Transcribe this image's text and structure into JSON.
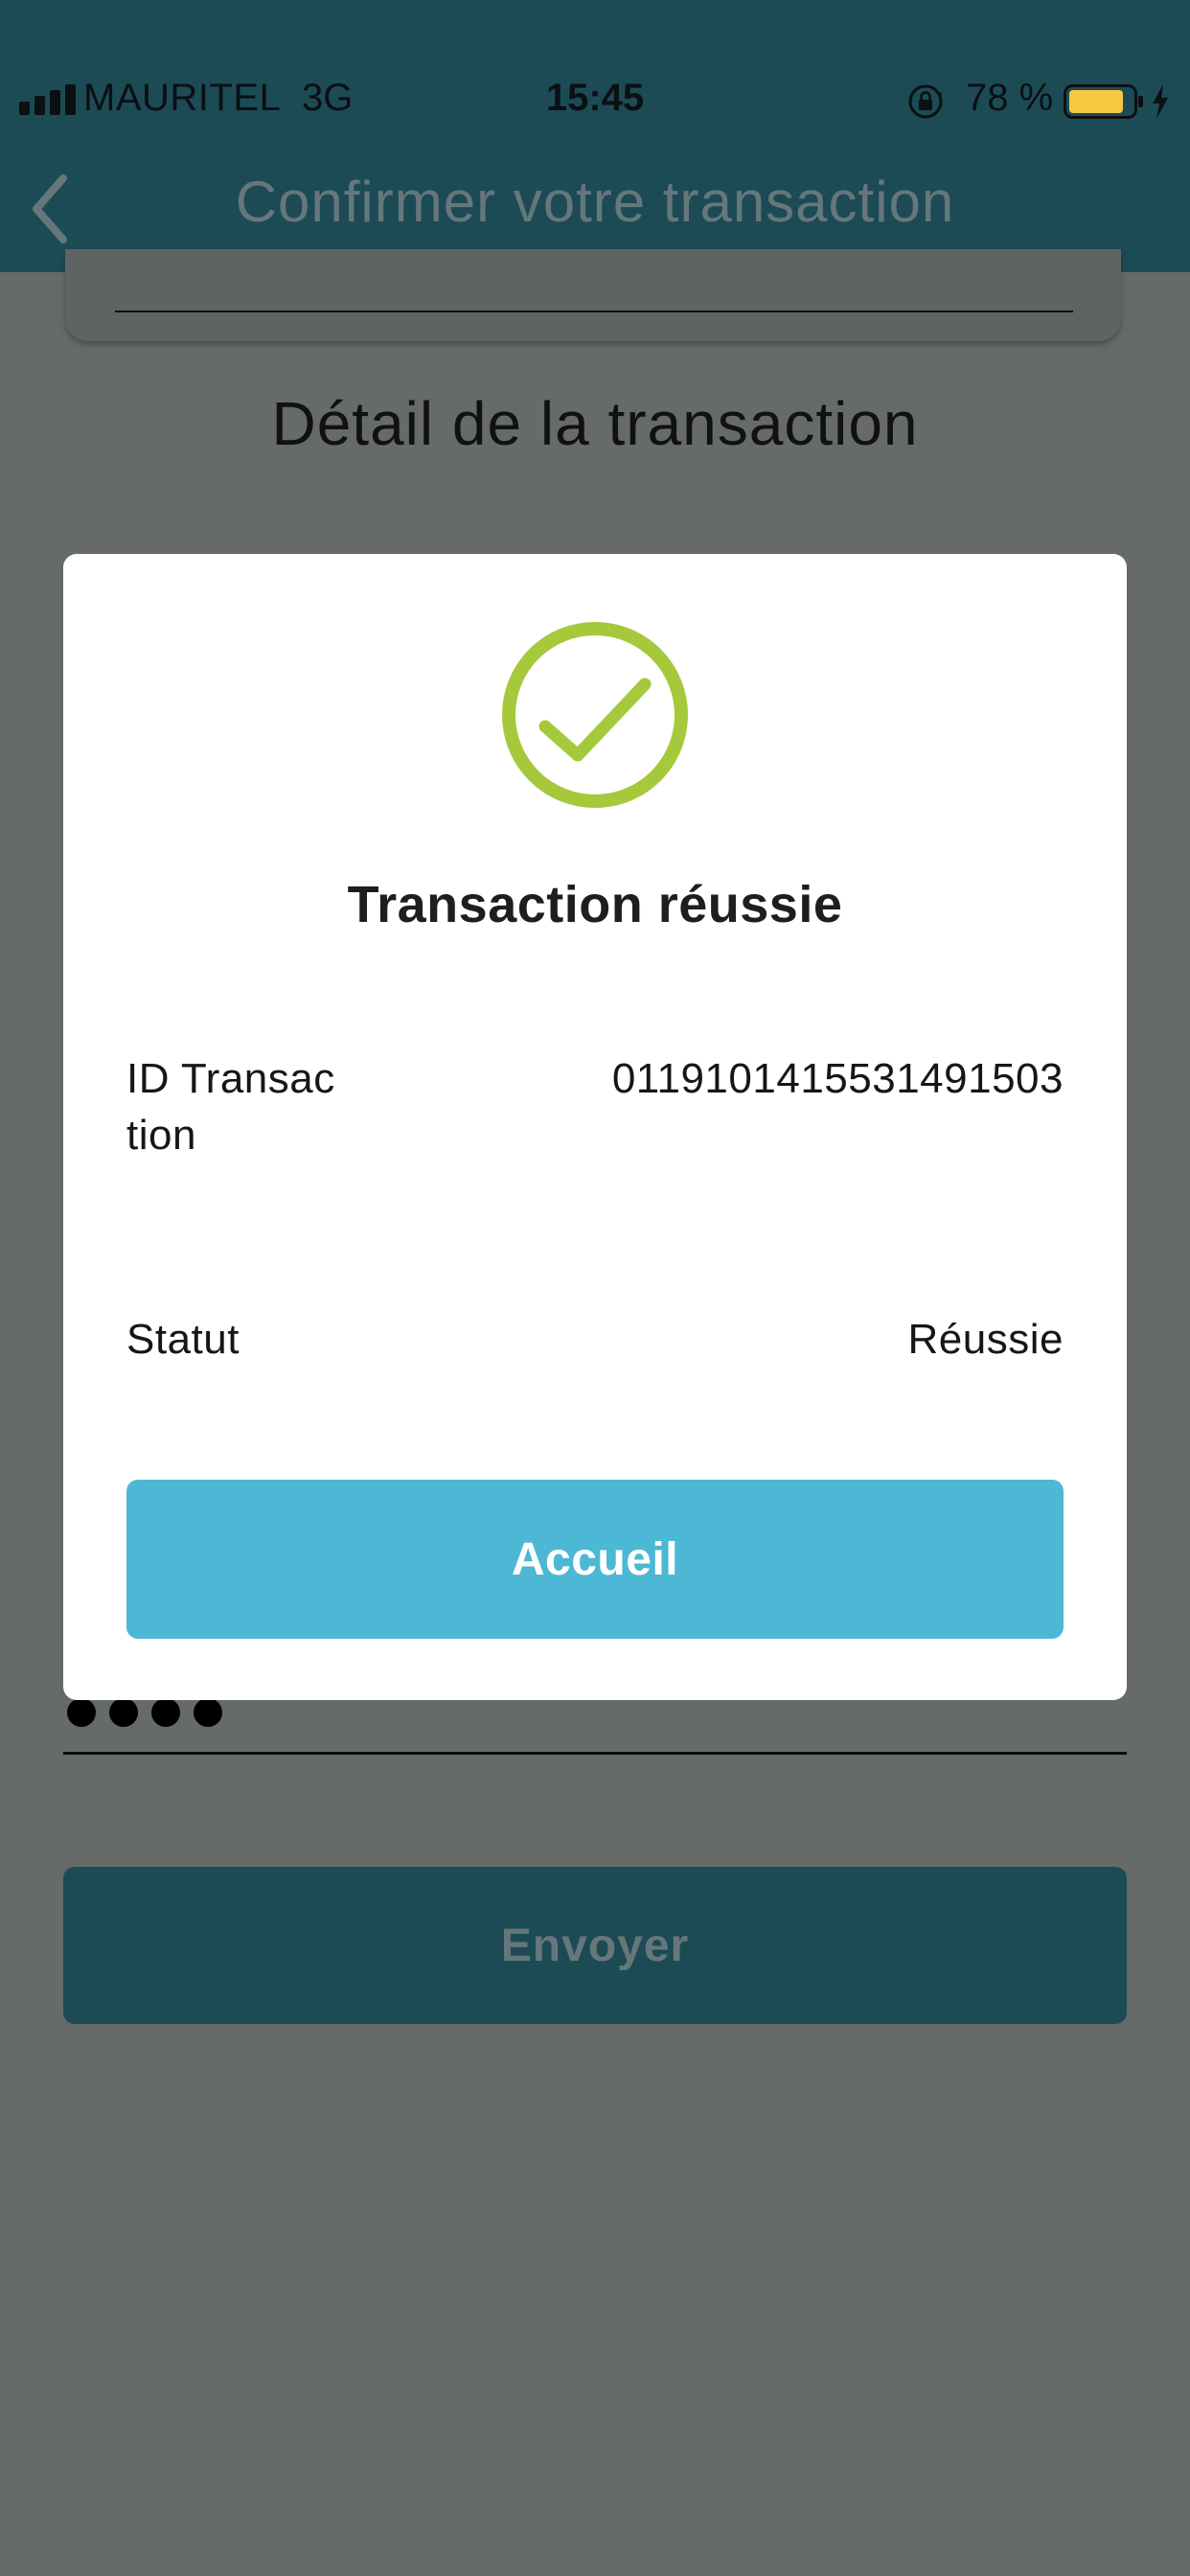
{
  "status_bar": {
    "carrier": "MAURITEL",
    "network": "3G",
    "time": "15:45",
    "battery": "78 %"
  },
  "header": {
    "title": "Confirmer votre transaction"
  },
  "background": {
    "section_title": "Détail de la transaction",
    "send_label": "Envoyer"
  },
  "modal": {
    "title": "Transaction réussie",
    "rows": [
      {
        "label": "ID Transaction",
        "value": "0119101415531491503"
      },
      {
        "label": "Statut",
        "value": "Réussie"
      }
    ],
    "button_label": "Accueil"
  },
  "colors": {
    "header": "#1c4b56",
    "overlay": "#666a69",
    "primary_button": "#4db8d5",
    "success": "#a5c93b",
    "battery": "#f5c842"
  },
  "icons": {
    "signal": "signal-bars-icon",
    "lock": "orientation-lock-icon",
    "battery": "battery-icon",
    "charging": "charging-bolt-icon",
    "back": "chevron-left-icon",
    "success": "check-circle-icon"
  }
}
